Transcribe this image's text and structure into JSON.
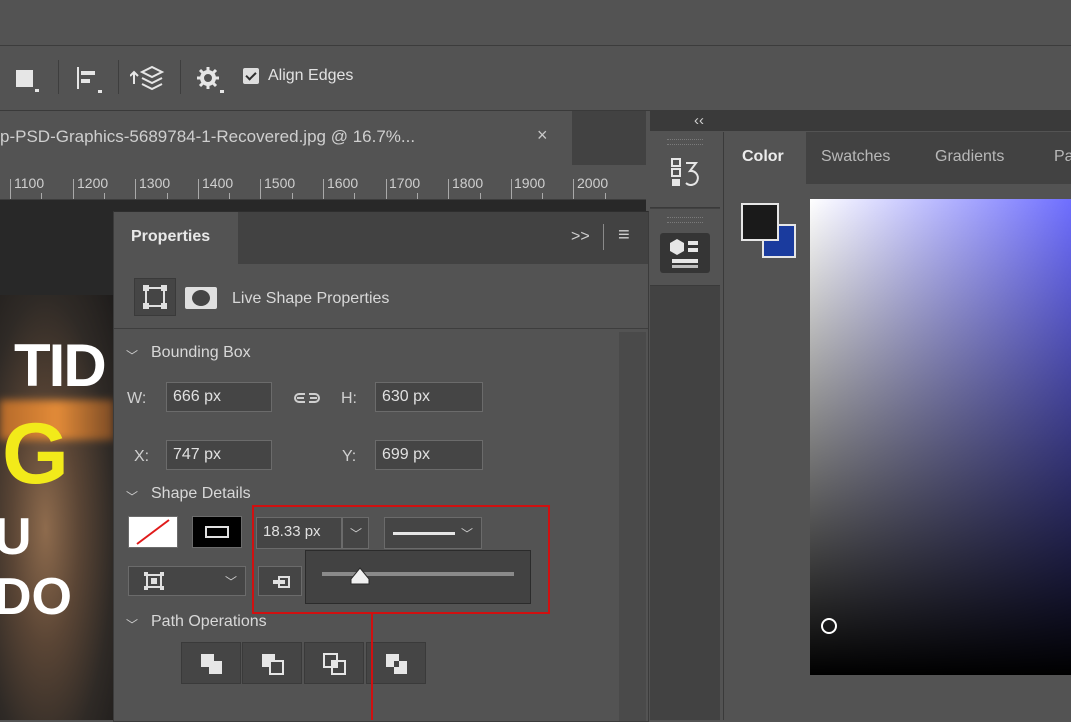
{
  "options_bar": {
    "align_edges_label": "Align Edges",
    "align_edges_checked": true
  },
  "document": {
    "tab_title": "p-PSD-Graphics-5689784-1-Recovered.jpg @ 16.7%...",
    "close_glyph": "×",
    "ruler_labels": [
      "1100",
      "1200",
      "1300",
      "1400",
      "1500",
      "1600",
      "1700",
      "1800",
      "1900",
      "2000"
    ],
    "artwork_text": [
      "TID",
      "G",
      "U DO"
    ]
  },
  "properties": {
    "title": "Properties",
    "expand_glyph": ">>",
    "menu_glyph": "≡",
    "live_shape_label": "Live Shape Properties",
    "bounding_box": {
      "label": "Bounding Box",
      "w_label": "W:",
      "w_value": "666 px",
      "h_label": "H:",
      "h_value": "630 px",
      "x_label": "X:",
      "x_value": "747 px",
      "y_label": "Y:",
      "y_value": "699 px",
      "link_glyph": "⊖⊝"
    },
    "shape_details": {
      "label": "Shape Details",
      "stroke_width": "18.33 px",
      "stroke_slider_level": 0.2
    },
    "path_operations": {
      "label": "Path Operations"
    }
  },
  "panel_strip": {
    "collapse_glyph": "‹‹"
  },
  "color_panel": {
    "tabs": [
      "Color",
      "Swatches",
      "Gradients",
      "Pa"
    ],
    "active_tab": "Color",
    "foreground": "#1a1a1a",
    "background": "#1a3b9e",
    "hue_color": "#6e6eff"
  },
  "colors": {
    "highlight": "#d01010",
    "panel": "#535353",
    "panel_dark": "#424242"
  }
}
